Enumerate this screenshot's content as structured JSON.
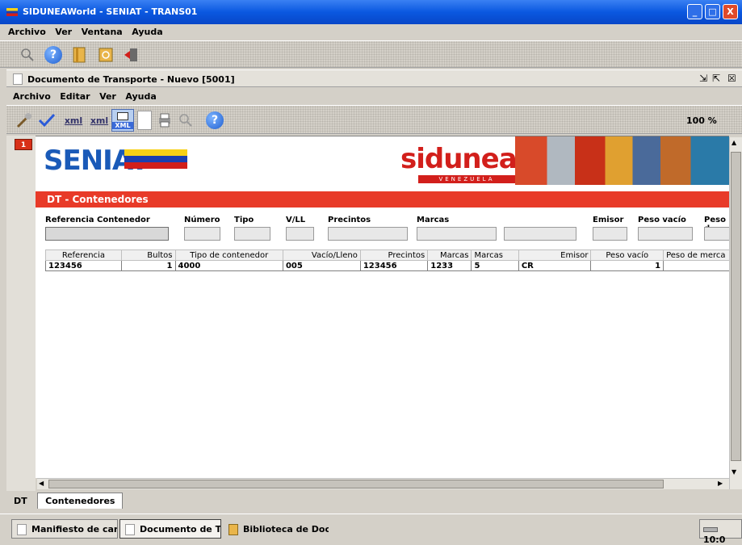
{
  "window": {
    "title": "SIDUNEAWorld - SENIAT - TRANS01",
    "controls": [
      "_",
      "□",
      "X"
    ]
  },
  "main_menu": [
    "Archivo",
    "Ver",
    "Ventana",
    "Ayuda"
  ],
  "main_toolbar": {
    "icons": [
      "search-icon",
      "help-icon",
      "library-icon",
      "mail-icon",
      "exit-icon"
    ],
    "help_glyph": "?"
  },
  "document": {
    "title": "Documento de Transporte - Nuevo [5001]",
    "menu": [
      "Archivo",
      "Editar",
      "Ver",
      "Ayuda"
    ],
    "zoom": "100 %",
    "toolbar_icons": [
      "tools-icon",
      "check-icon",
      "xml-import-icon",
      "xml-export-icon",
      "xml-icon",
      "new-page-icon",
      "print-icon",
      "search-icon",
      "help-icon"
    ],
    "xml_label": "XML",
    "xml_in": "xml",
    "xml_out": "xml"
  },
  "header": {
    "seniat_logo": "SENIAT",
    "sidunea_logo": "sidunea",
    "sidunea_sub": "VENEZUELA",
    "page_indicator": "1",
    "section_title": "DT - Contenedores"
  },
  "form": {
    "labels": {
      "ref": "Referencia Contenedor",
      "numero": "Número",
      "tipo": "Tipo",
      "vll": "V/LL",
      "precintos": "Precintos",
      "marcas": "Marcas",
      "emisor": "Emisor",
      "peso_vacio": "Peso vacío",
      "peso_d": "Peso d"
    }
  },
  "table": {
    "headers": [
      "Referencia",
      "Bultos",
      "Tipo de contenedor",
      "Vacío/Lleno",
      "Precintos",
      "Marcas",
      "Marcas",
      "Emisor",
      "Peso vacío",
      "Peso de merca"
    ],
    "rows": [
      [
        "123456",
        "1",
        "4000",
        "005",
        "123456",
        "1233",
        "5",
        "CR",
        "1",
        ""
      ]
    ]
  },
  "tabs": [
    "DT",
    "Contenedores"
  ],
  "taskbar": {
    "items": [
      "Manifiesto de carg...",
      "Documento de Tr...",
      "Biblioteca de Doc..."
    ],
    "clock": "10:0"
  }
}
